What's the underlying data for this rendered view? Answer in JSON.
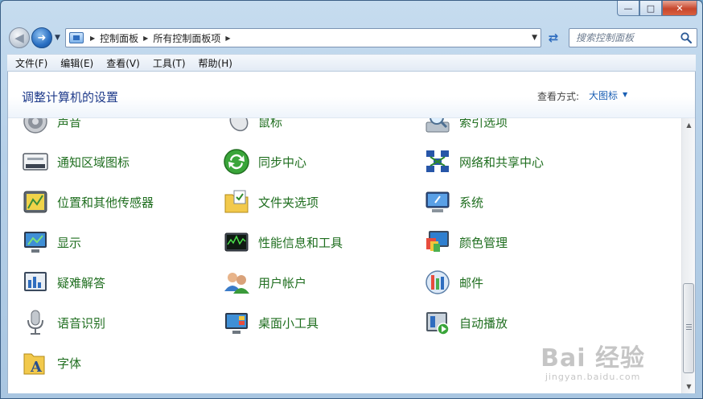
{
  "window": {
    "caption": {
      "minimize": "—",
      "maximize": "□",
      "close": "✕"
    }
  },
  "nav": {
    "back_icon": "arrow-left-icon",
    "forward_icon": "arrow-right-icon",
    "breadcrumbs": [
      "控制面板",
      "所有控制面板项"
    ],
    "search_placeholder": "搜索控制面板"
  },
  "menubar": {
    "items": [
      "文件(F)",
      "编辑(E)",
      "查看(V)",
      "工具(T)",
      "帮助(H)"
    ]
  },
  "header": {
    "title": "调整计算机的设置",
    "view_label": "查看方式:",
    "view_value": "大图标"
  },
  "items": [
    {
      "label": "声音",
      "icon": "speaker-icon"
    },
    {
      "label": "鼠标",
      "icon": "mouse-icon"
    },
    {
      "label": "索引选项",
      "icon": "index-search-icon"
    },
    {
      "label": "通知区域图标",
      "icon": "notification-tray-icon"
    },
    {
      "label": "同步中心",
      "icon": "sync-icon"
    },
    {
      "label": "网络和共享中心",
      "icon": "network-icon"
    },
    {
      "label": "位置和其他传感器",
      "icon": "location-sensor-icon"
    },
    {
      "label": "文件夹选项",
      "icon": "folder-options-icon"
    },
    {
      "label": "系统",
      "icon": "system-icon"
    },
    {
      "label": "显示",
      "icon": "display-icon"
    },
    {
      "label": "性能信息和工具",
      "icon": "performance-icon"
    },
    {
      "label": "颜色管理",
      "icon": "color-management-icon"
    },
    {
      "label": "疑难解答",
      "icon": "troubleshoot-icon"
    },
    {
      "label": "用户帐户",
      "icon": "user-accounts-icon"
    },
    {
      "label": "邮件",
      "icon": "mail-icon"
    },
    {
      "label": "语音识别",
      "icon": "microphone-icon"
    },
    {
      "label": "桌面小工具",
      "icon": "gadgets-icon"
    },
    {
      "label": "自动播放",
      "icon": "autoplay-icon"
    },
    {
      "label": "字体",
      "icon": "fonts-icon"
    }
  ],
  "watermark": {
    "main": "Bai 经验",
    "sub": "jingyan.baidu.com"
  },
  "colors": {
    "link_green": "#1f6e1f",
    "title_blue": "#1e3a8a",
    "accent": "#1a5fb4"
  }
}
